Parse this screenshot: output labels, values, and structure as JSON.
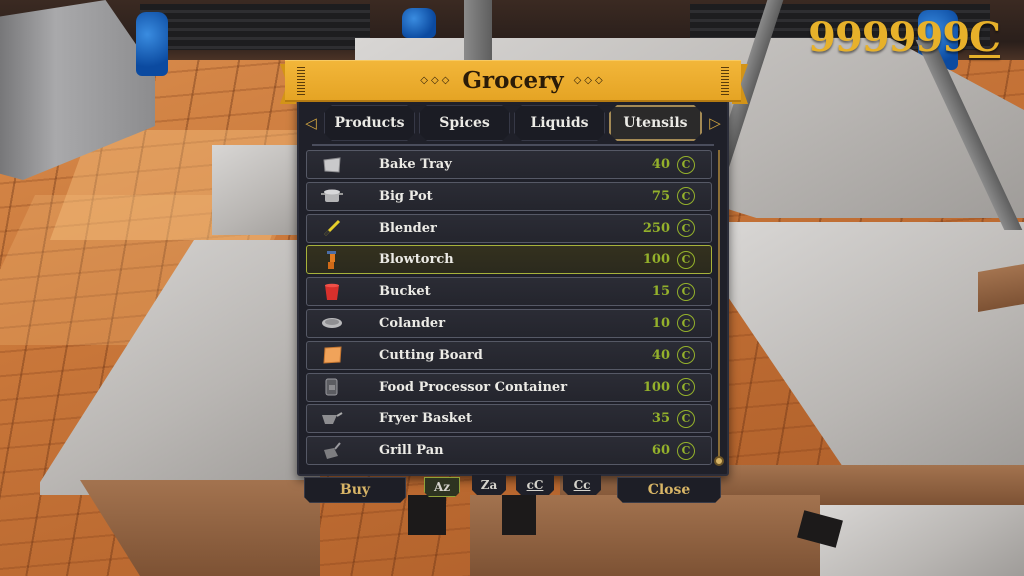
{
  "hud": {
    "money_value": "999999",
    "currency_symbol": "C",
    "currency_icon": "coin-icon"
  },
  "shop": {
    "title": "Grocery",
    "title_ornament_left": "◇◇◇",
    "title_ornament_right": "◇◇◇",
    "tabs": [
      {
        "label": "Products",
        "active": false
      },
      {
        "label": "Spices",
        "active": false
      },
      {
        "label": "Liquids",
        "active": false
      },
      {
        "label": "Utensils",
        "active": true
      }
    ],
    "prev_tab_icon": "triangle-left-icon",
    "next_tab_icon": "triangle-right-icon",
    "items": [
      {
        "name": "Bake Tray",
        "price": "40",
        "icon": "bake-tray-icon",
        "selected": false
      },
      {
        "name": "Big Pot",
        "price": "75",
        "icon": "pot-icon",
        "selected": false
      },
      {
        "name": "Blender",
        "price": "250",
        "icon": "blender-icon",
        "selected": false
      },
      {
        "name": "Blowtorch",
        "price": "100",
        "icon": "blowtorch-icon",
        "selected": true
      },
      {
        "name": "Bucket",
        "price": "15",
        "icon": "bucket-icon",
        "selected": false
      },
      {
        "name": "Colander",
        "price": "10",
        "icon": "colander-icon",
        "selected": false
      },
      {
        "name": "Cutting Board",
        "price": "40",
        "icon": "cutting-board-icon",
        "selected": false
      },
      {
        "name": "Food Processor Container",
        "price": "100",
        "icon": "food-processor-icon",
        "selected": false
      },
      {
        "name": "Fryer Basket",
        "price": "35",
        "icon": "fryer-basket-icon",
        "selected": false
      },
      {
        "name": "Grill Pan",
        "price": "60",
        "icon": "grill-pan-icon",
        "selected": false
      }
    ],
    "price_coin_glyph": "C",
    "scroll_position": 1.0,
    "buttons": {
      "buy": "Buy",
      "close": "Close"
    },
    "sort_options": [
      {
        "label": "Az",
        "active": true
      },
      {
        "label": "Za",
        "active": false
      },
      {
        "label": "cC",
        "active": false
      },
      {
        "label": "Cc",
        "active": false
      }
    ]
  },
  "colors": {
    "banner": "#E5A424",
    "panel": "#1F2029",
    "price_green": "#94B12B",
    "selected_border": "#A7B23A",
    "gold_text": "#D8B566",
    "money": "#E7B12A"
  }
}
